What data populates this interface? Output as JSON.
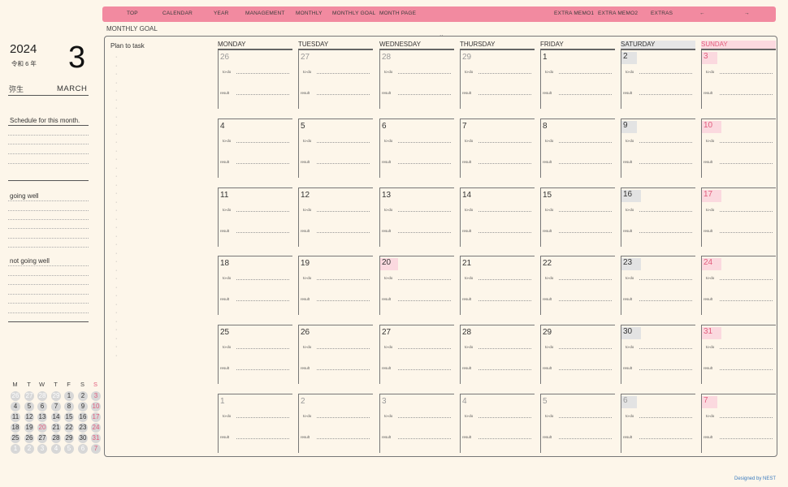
{
  "nav": {
    "items": [
      "TOP",
      "CALENDAR",
      "YEAR",
      "MANAGEMENT",
      "MONTHLY",
      "MONTHLY GOAL",
      "MONTH PAGE",
      "EXTRA MEMO1",
      "EXTRA MEMO2",
      "EXTRAS",
      "←",
      "→"
    ],
    "color": "#f28aa0"
  },
  "monthly_goal_label": "MONTHLY GOAL",
  "sidebar": {
    "year": "2024",
    "japanese_era": "令和 6 年",
    "month_number": "3",
    "japanese_month": "弥生",
    "month_name": "MARCH",
    "schedule_title": "Schedule for this month.",
    "going_well": "going well",
    "not_going_well": "not going well"
  },
  "mini_calendar": {
    "headers": [
      "M",
      "T",
      "W",
      "T",
      "F",
      "S",
      "S"
    ],
    "weeks": [
      [
        "26",
        "27",
        "28",
        "29",
        "1",
        "2",
        "3"
      ],
      [
        "4",
        "5",
        "6",
        "7",
        "8",
        "9",
        "10"
      ],
      [
        "11",
        "12",
        "13",
        "14",
        "15",
        "16",
        "17"
      ],
      [
        "18",
        "19",
        "20",
        "21",
        "22",
        "23",
        "24"
      ],
      [
        "25",
        "26",
        "27",
        "28",
        "29",
        "30",
        "31"
      ],
      [
        "1",
        "2",
        "3",
        "4",
        "5",
        "6",
        "7"
      ]
    ]
  },
  "plan_to_task": "Plan to task",
  "days": [
    "MONDAY",
    "TUESDAY",
    "WEDNESDAY",
    "THURSDAY",
    "FRIDAY",
    "SATURDAY",
    "SUNDAY"
  ],
  "weeks": [
    [
      "26",
      "27",
      "28",
      "29",
      "1",
      "2",
      "3"
    ],
    [
      "4",
      "5",
      "6",
      "7",
      "8",
      "9",
      "10"
    ],
    [
      "11",
      "12",
      "13",
      "14",
      "15",
      "16",
      "17"
    ],
    [
      "18",
      "19",
      "20",
      "21",
      "22",
      "23",
      "24"
    ],
    [
      "25",
      "26",
      "27",
      "28",
      "29",
      "30",
      "31"
    ],
    [
      "1",
      "2",
      "3",
      "4",
      "5",
      "6",
      "7"
    ]
  ],
  "todo_label": "to-do",
  "result_label": "result",
  "accent_pink": "#f28aa0",
  "sunday_color": "#e25c7c",
  "designed_by": "Designed by NEST"
}
